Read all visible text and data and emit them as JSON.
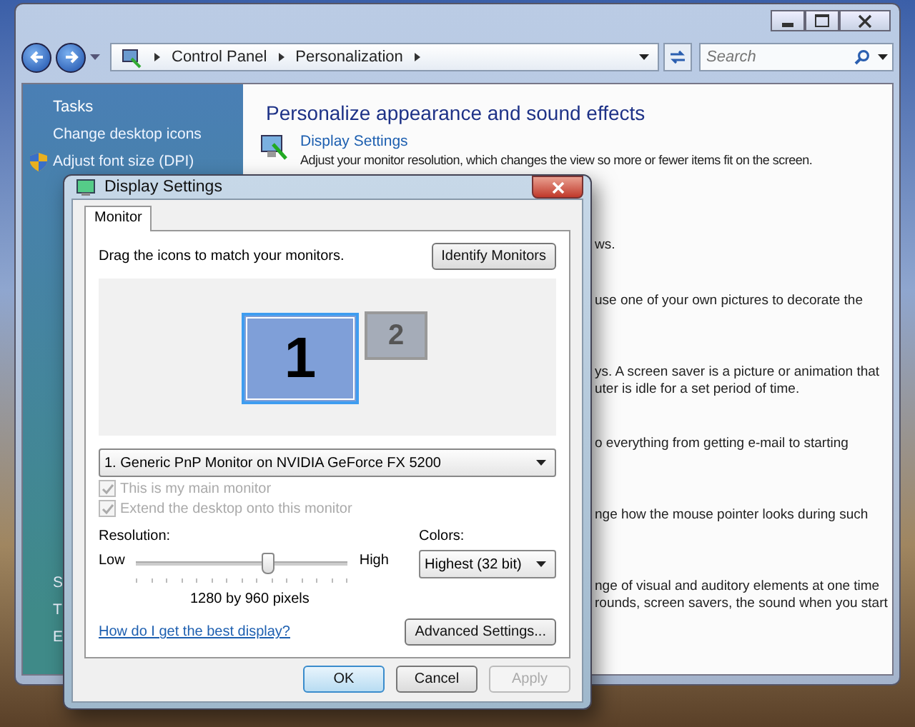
{
  "window": {
    "breadcrumbs": [
      "Control Panel",
      "Personalization"
    ],
    "search": {
      "placeholder": "Search"
    }
  },
  "sidebar": {
    "title": "Tasks",
    "items": [
      {
        "label": "Change desktop icons",
        "kind": "link"
      },
      {
        "label": "Adjust font size (DPI)",
        "kind": "shield"
      }
    ],
    "covered_items": [
      "S",
      "T",
      "E"
    ]
  },
  "main": {
    "heading": "Personalize appearance and sound effects",
    "link": "Display Settings",
    "description": "Adjust your monitor resolution, which changes the view so more or fewer items fit on the screen.",
    "fragments": [
      {
        "lines": [
          "ws."
        ]
      },
      {
        "lines": [
          "use one of your own pictures to decorate the"
        ]
      },
      {
        "lines": [
          "ys. A screen saver is a picture or animation that",
          "uter is idle for a set period of time."
        ]
      },
      {
        "lines": [
          "o everything from getting e-mail to starting"
        ]
      },
      {
        "lines": [
          "nge how the mouse pointer looks during such"
        ]
      },
      {
        "lines": [
          "nge of visual and auditory elements at one time",
          "rounds, screen savers, the sound when you start"
        ]
      }
    ]
  },
  "dialog": {
    "title": "Display Settings",
    "tabs": [
      {
        "label": "Monitor",
        "selected": true
      }
    ],
    "instruction": "Drag the icons to match your monitors.",
    "identify_button": "Identify Monitors",
    "monitors": [
      {
        "label": "1",
        "selected": true
      },
      {
        "label": "2",
        "selected": false
      }
    ],
    "monitor_select": "1. Generic PnP Monitor on NVIDIA GeForce FX 5200",
    "checkboxes": [
      {
        "label": "This is my main monitor",
        "checked": true,
        "disabled": true
      },
      {
        "label": "Extend the desktop onto this monitor",
        "checked": true,
        "disabled": true
      }
    ],
    "resolution": {
      "label": "Resolution:",
      "low": "Low",
      "high": "High",
      "level": 0.61,
      "reading": "1280 by 960 pixels"
    },
    "colors": {
      "label": "Colors:",
      "value": "Highest (32 bit)"
    },
    "help_link": "How do I get the best display?",
    "advanced_button": "Advanced Settings...",
    "buttons": [
      {
        "label": "OK",
        "kind": "default",
        "disabled": false
      },
      {
        "label": "Cancel",
        "kind": "normal",
        "disabled": false
      },
      {
        "label": "Apply",
        "kind": "normal",
        "disabled": true
      }
    ]
  }
}
